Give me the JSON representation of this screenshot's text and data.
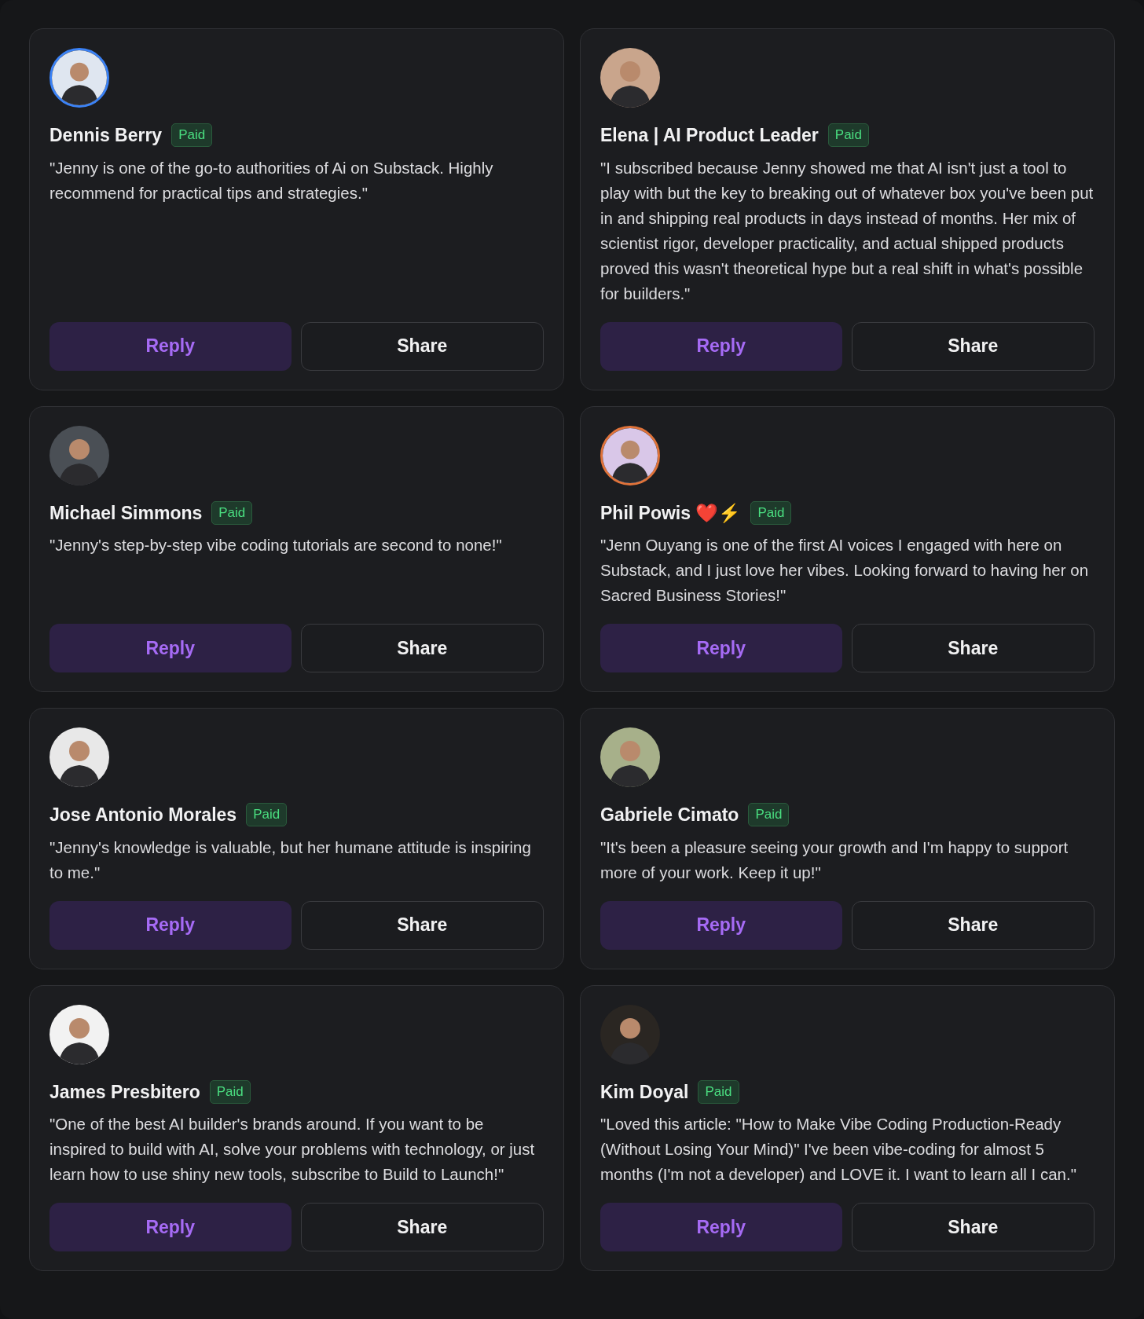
{
  "testimonials": [
    {
      "name": "Dennis Berry",
      "badge": "Paid",
      "color": "#3b82f6",
      "quote": "\"Jenny is one of the go-to authorities of Ai on Substack. Highly recommend for practical tips and strategies.\"",
      "actions": [
        "Reply",
        "Share"
      ]
    },
    {
      "name": "Elena | AI Product Leader",
      "badge": "Paid",
      "quote": "\"I subscribed because Jenny showed me that AI isn't just a tool to play with but the key to breaking out of whatever box you've been put in and shipping real products in days instead of months. Her mix of scientist rigor, developer practicality, and actual shipped products proved this wasn't theoretical hype but a real shift in what's possible for builders.\"",
      "actions": [
        "Reply",
        "Share"
      ]
    },
    {
      "name": "Michael Simmons",
      "badge": "Paid",
      "quote": "\"Jenny's step-by-step vibe coding tutorials are second to none!\"",
      "actions": [
        "Reply",
        "Share"
      ]
    },
    {
      "name": "Phil Powis ❤️⚡",
      "badge": "Paid",
      "color": "#e0733a",
      "quote": "\"Jenn Ouyang is one of the first AI voices I engaged with here on Substack, and I just love her vibes. Looking forward to having her on Sacred Business Stories!\"",
      "actions": [
        "Reply",
        "Share"
      ]
    },
    {
      "name": "Jose Antonio Morales",
      "badge": "Paid",
      "quote": "\"Jenny's knowledge is valuable, but her humane attitude is inspiring to me.\"",
      "actions": [
        "Reply",
        "Share"
      ]
    },
    {
      "name": "Gabriele Cimato",
      "badge": "Paid",
      "quote": "\"It's been a pleasure seeing your growth and I'm happy to support more of your work. Keep it up!\"",
      "actions": [
        "Reply",
        "Share"
      ]
    },
    {
      "name": "James Presbitero",
      "badge": "Paid",
      "quote": "\"One of the best AI builder's brands around. If you want to be inspired to build with AI, solve your problems with technology, or just learn how to use shiny new tools, subscribe to Build to Launch!\"",
      "actions": [
        "Reply",
        "Share"
      ]
    },
    {
      "name": "Kim Doyal",
      "badge": "Paid",
      "quote": "\"Loved this article: \"How to Make Vibe Coding Production-Ready (Without Losing Your Mind)\" I've been vibe-coding for almost 5 months (I'm not a developer) and LOVE it. I want to learn all I can.\"",
      "actions": [
        "Reply",
        "Share"
      ]
    }
  ]
}
